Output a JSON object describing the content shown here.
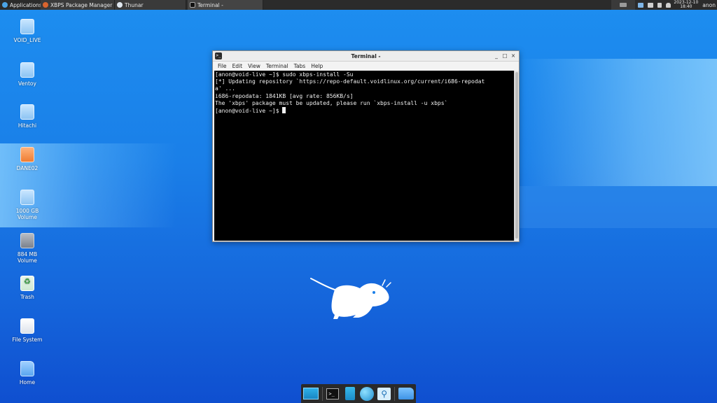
{
  "top_panel": {
    "applications_label": "Applications",
    "tasks": [
      {
        "label": "XBPS Package Manager ..."
      },
      {
        "label": "Thunar"
      },
      {
        "label": "Terminal -"
      }
    ],
    "clock_date": "2023-12-10",
    "clock_time": "18:40",
    "user": "anon"
  },
  "desktop_icons": [
    {
      "label": "VOID_LIVE",
      "icon": "drive-icon"
    },
    {
      "label": "Ventoy",
      "icon": "drive-icon"
    },
    {
      "label": "Hitachi",
      "icon": "drive-icon"
    },
    {
      "label": "DANE02",
      "icon": "drive-icon"
    },
    {
      "label": "1000 GB\nVolume",
      "icon": "drive-icon"
    },
    {
      "label": "884 MB\nVolume",
      "icon": "drive-icon"
    },
    {
      "label": "Trash",
      "icon": "trash-icon"
    },
    {
      "label": "File System",
      "icon": "filesystem-icon"
    },
    {
      "label": "Home",
      "icon": "home-folder-icon"
    }
  ],
  "terminal": {
    "title": "Terminal -",
    "menu": [
      "File",
      "Edit",
      "View",
      "Terminal",
      "Tabs",
      "Help"
    ],
    "lines": [
      "[anon@void-live ~]$ sudo xbps-install -Su",
      "[*] Updating repository `https://repo-default.voidlinux.org/current/i686-repodat",
      "a' ...",
      "i686-repodata: 1841KB [avg rate: 856KB/s]",
      "The 'xbps' package must be updated, please run `xbps-install -u xbps`",
      "[anon@void-live ~]$ "
    ],
    "minimize": "_",
    "maximize": "□",
    "close": "×"
  },
  "dock": {
    "items": [
      "desktop-icon",
      "terminal-icon",
      "files-icon",
      "web-browser-icon",
      "search-icon",
      "folder-icon"
    ]
  }
}
